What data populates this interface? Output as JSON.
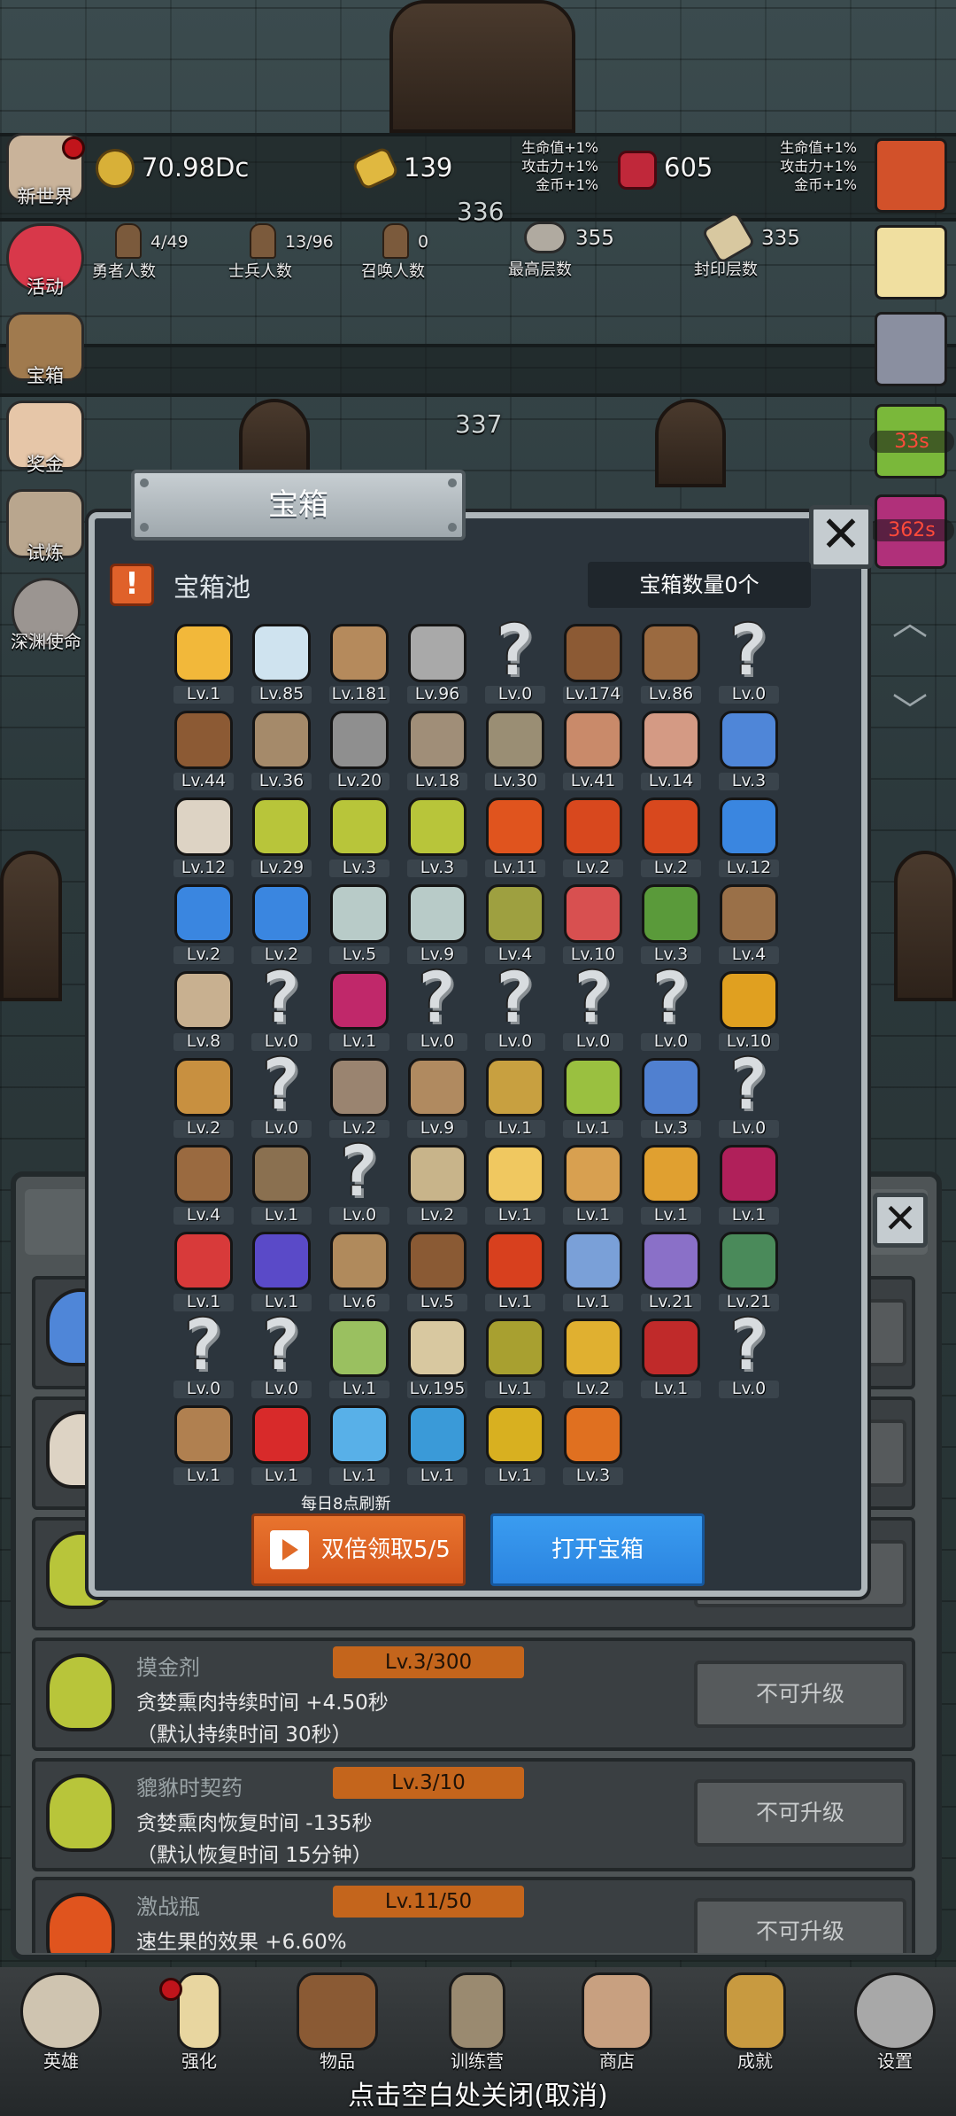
{
  "top_bar": {
    "gold": "70.98Dc",
    "gold_bars": "139",
    "gems": "605",
    "bonus_left": [
      "生命值+1%",
      "攻击力+1%",
      "金币+1%"
    ],
    "bonus_right": [
      "生命值+1%",
      "攻击力+1%",
      "金币+1%"
    ],
    "floor_a": "336",
    "floor_b": "337"
  },
  "stats": {
    "heroes": {
      "value": "4/49",
      "label": "勇者人数"
    },
    "soldiers": {
      "value": "13/96",
      "label": "士兵人数"
    },
    "summons": {
      "value": "0",
      "label": "召唤人数"
    },
    "highest": {
      "value": "355",
      "label": "最高层数"
    },
    "sealed": {
      "value": "335",
      "label": "封印层数"
    }
  },
  "left_menu": [
    {
      "label": "新世界",
      "color": "#c9b39a"
    },
    {
      "label": "活动",
      "color": "#d8384a"
    },
    {
      "label": "宝箱",
      "color": "#a07a4e"
    },
    {
      "label": "奖金",
      "color": "#e6c6a8"
    },
    {
      "label": "试炼",
      "color": "#b9a68e"
    },
    {
      "label": "深渊使命",
      "color": "#9b9591"
    }
  ],
  "right_side": {
    "timers": [
      "33s",
      "362s"
    ],
    "colors": [
      "#d2512a",
      "#f0dfa0",
      "#8a8fa0",
      "#7ab83a",
      "#b0307a"
    ]
  },
  "dialog": {
    "title": "宝箱",
    "pool_title": "宝箱池",
    "alert_glyph": "!",
    "count_text": "宝箱数量0个",
    "refresh_text": "每日8点刷新",
    "double_button": "双倍领取5/5",
    "open_button": "打开宝箱",
    "close_glyph": "✕",
    "items": [
      {
        "lv": "Lv.1",
        "c": "#f2b83a"
      },
      {
        "lv": "Lv.85",
        "c": "#cfe3ef"
      },
      {
        "lv": "Lv.181",
        "c": "#b58a5c"
      },
      {
        "lv": "Lv.96",
        "c": "#a9a9a9"
      },
      {
        "lv": "Lv.0",
        "c": "?"
      },
      {
        "lv": "Lv.174",
        "c": "#8c5a34"
      },
      {
        "lv": "Lv.86",
        "c": "#9b6a40"
      },
      {
        "lv": "Lv.0",
        "c": "?"
      },
      {
        "lv": "Lv.44",
        "c": "#8c5a34"
      },
      {
        "lv": "Lv.36",
        "c": "#a58a6a"
      },
      {
        "lv": "Lv.20",
        "c": "#8f8f8f"
      },
      {
        "lv": "Lv.18",
        "c": "#a08e78"
      },
      {
        "lv": "Lv.30",
        "c": "#9a8e74"
      },
      {
        "lv": "Lv.41",
        "c": "#c98a6a"
      },
      {
        "lv": "Lv.14",
        "c": "#d49a84"
      },
      {
        "lv": "Lv.3",
        "c": "#4f86d8"
      },
      {
        "lv": "Lv.12",
        "c": "#ddd3c4"
      },
      {
        "lv": "Lv.29",
        "c": "#b8c53a"
      },
      {
        "lv": "Lv.3",
        "c": "#b8c53a"
      },
      {
        "lv": "Lv.3",
        "c": "#b8c53a"
      },
      {
        "lv": "Lv.11",
        "c": "#e0541e"
      },
      {
        "lv": "Lv.2",
        "c": "#d8481e"
      },
      {
        "lv": "Lv.2",
        "c": "#d8481e"
      },
      {
        "lv": "Lv.12",
        "c": "#3a86e0"
      },
      {
        "lv": "Lv.2",
        "c": "#3a86e0"
      },
      {
        "lv": "Lv.2",
        "c": "#3a86e0"
      },
      {
        "lv": "Lv.5",
        "c": "#b8cbc8"
      },
      {
        "lv": "Lv.9",
        "c": "#b8cbc8"
      },
      {
        "lv": "Lv.4",
        "c": "#9ea040"
      },
      {
        "lv": "Lv.10",
        "c": "#d85050"
      },
      {
        "lv": "Lv.3",
        "c": "#5a9a3a"
      },
      {
        "lv": "Lv.4",
        "c": "#9a7048"
      },
      {
        "lv": "Lv.8",
        "c": "#c8b090"
      },
      {
        "lv": "Lv.0",
        "c": "?"
      },
      {
        "lv": "Lv.1",
        "c": "#c0286a"
      },
      {
        "lv": "Lv.0",
        "c": "?"
      },
      {
        "lv": "Lv.0",
        "c": "?"
      },
      {
        "lv": "Lv.0",
        "c": "?"
      },
      {
        "lv": "Lv.0",
        "c": "?"
      },
      {
        "lv": "Lv.10",
        "c": "#e0a020"
      },
      {
        "lv": "Lv.2",
        "c": "#c89040"
      },
      {
        "lv": "Lv.0",
        "c": "?"
      },
      {
        "lv": "Lv.2",
        "c": "#9a8470"
      },
      {
        "lv": "Lv.9",
        "c": "#b08a60"
      },
      {
        "lv": "Lv.1",
        "c": "#c8a040"
      },
      {
        "lv": "Lv.1",
        "c": "#9ac040"
      },
      {
        "lv": "Lv.3",
        "c": "#5080d0"
      },
      {
        "lv": "Lv.0",
        "c": "?"
      },
      {
        "lv": "Lv.4",
        "c": "#9a6a40"
      },
      {
        "lv": "Lv.1",
        "c": "#8a7050"
      },
      {
        "lv": "Lv.0",
        "c": "?"
      },
      {
        "lv": "Lv.2",
        "c": "#c8b48a"
      },
      {
        "lv": "Lv.1",
        "c": "#f0c860"
      },
      {
        "lv": "Lv.1",
        "c": "#d8a050"
      },
      {
        "lv": "Lv.1",
        "c": "#e0a030"
      },
      {
        "lv": "Lv.1",
        "c": "#b0205a"
      },
      {
        "lv": "Lv.1",
        "c": "#d83a3a"
      },
      {
        "lv": "Lv.1",
        "c": "#5a4ac8"
      },
      {
        "lv": "Lv.6",
        "c": "#b08a5c"
      },
      {
        "lv": "Lv.5",
        "c": "#8a5a34"
      },
      {
        "lv": "Lv.1",
        "c": "#d8401e"
      },
      {
        "lv": "Lv.1",
        "c": "#7aa0d8"
      },
      {
        "lv": "Lv.21",
        "c": "#8a70c8"
      },
      {
        "lv": "Lv.21",
        "c": "#4a8a5a"
      },
      {
        "lv": "Lv.0",
        "c": "?"
      },
      {
        "lv": "Lv.0",
        "c": "?"
      },
      {
        "lv": "Lv.1",
        "c": "#9ac060"
      },
      {
        "lv": "Lv.195",
        "c": "#d8c8a0"
      },
      {
        "lv": "Lv.1",
        "c": "#a8a030"
      },
      {
        "lv": "Lv.2",
        "c": "#e0b030"
      },
      {
        "lv": "Lv.1",
        "c": "#c02a2a"
      },
      {
        "lv": "Lv.0",
        "c": "?"
      },
      {
        "lv": "Lv.1",
        "c": "#b08050"
      },
      {
        "lv": "Lv.1",
        "c": "#d82a2a"
      },
      {
        "lv": "Lv.1",
        "c": "#58b0e8"
      },
      {
        "lv": "Lv.1",
        "c": "#3a9ad8"
      },
      {
        "lv": "Lv.1",
        "c": "#d8b020"
      },
      {
        "lv": "Lv.3",
        "c": "#e07020"
      }
    ]
  },
  "back_panel": {
    "rows": [
      {
        "title": "摸金剂",
        "level": "Lv.3/300",
        "desc1": "贪婪熏肉持续时间 +4.50秒",
        "desc2": "（默认持续时间 30秒）",
        "button": "不可升级",
        "color": "#b8c53a"
      },
      {
        "title": "貔貅时契药",
        "level": "Lv.3/10",
        "desc1": "贪婪熏肉恢复时间 -135秒",
        "desc2": "（默认恢复时间 15分钟）",
        "button": "不可升级",
        "color": "#b8c53a"
      },
      {
        "title": "激战瓶",
        "level": "Lv.11/50",
        "desc1": "速生果的效果 +6.60%",
        "desc2": "",
        "button": "不可升级",
        "color": "#e0541e"
      }
    ]
  },
  "bottom_nav": [
    {
      "label": "英雄",
      "color": "#cfc4b0"
    },
    {
      "label": "强化",
      "color": "#e8d6a0"
    },
    {
      "label": "物品",
      "color": "#8a5a34"
    },
    {
      "label": "训练营",
      "color": "#9a8a70"
    },
    {
      "label": "商店",
      "color": "#c8a080"
    },
    {
      "label": "成就",
      "color": "#c89a40"
    },
    {
      "label": "设置",
      "color": "#a8a8a8"
    }
  ],
  "close_hint": "点击空白处关闭(取消)"
}
